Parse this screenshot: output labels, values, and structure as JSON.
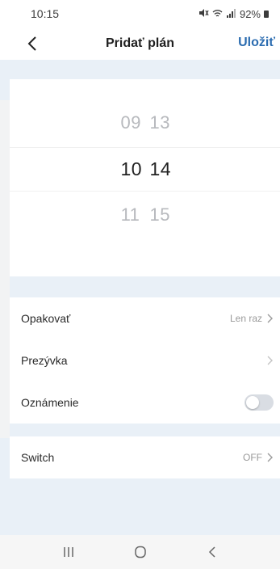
{
  "status_bar": {
    "time": "10:15",
    "battery": "92%"
  },
  "header": {
    "title": "Pridať plán",
    "save_label": "Uložiť"
  },
  "time_picker": {
    "rows": [
      {
        "hour": "09",
        "minute": "13",
        "selected": false
      },
      {
        "hour": "10",
        "minute": "14",
        "selected": true
      },
      {
        "hour": "11",
        "minute": "15",
        "selected": false
      }
    ]
  },
  "settings": {
    "repeat": {
      "label": "Opakovať",
      "value": "Len raz"
    },
    "nickname": {
      "label": "Prezývka",
      "value": ""
    },
    "notification": {
      "label": "Oznámenie",
      "enabled": false
    }
  },
  "switch": {
    "label": "Switch",
    "value": "OFF"
  },
  "colors": {
    "accent": "#2b6cb0",
    "background": "#e9f0f7",
    "card": "#ffffff"
  },
  "icons": {
    "back": "chevron-left-icon",
    "row_chevron": "chevron-right-icon",
    "nav_recent": "recent-apps-icon",
    "nav_home": "home-icon",
    "nav_back": "back-icon"
  }
}
